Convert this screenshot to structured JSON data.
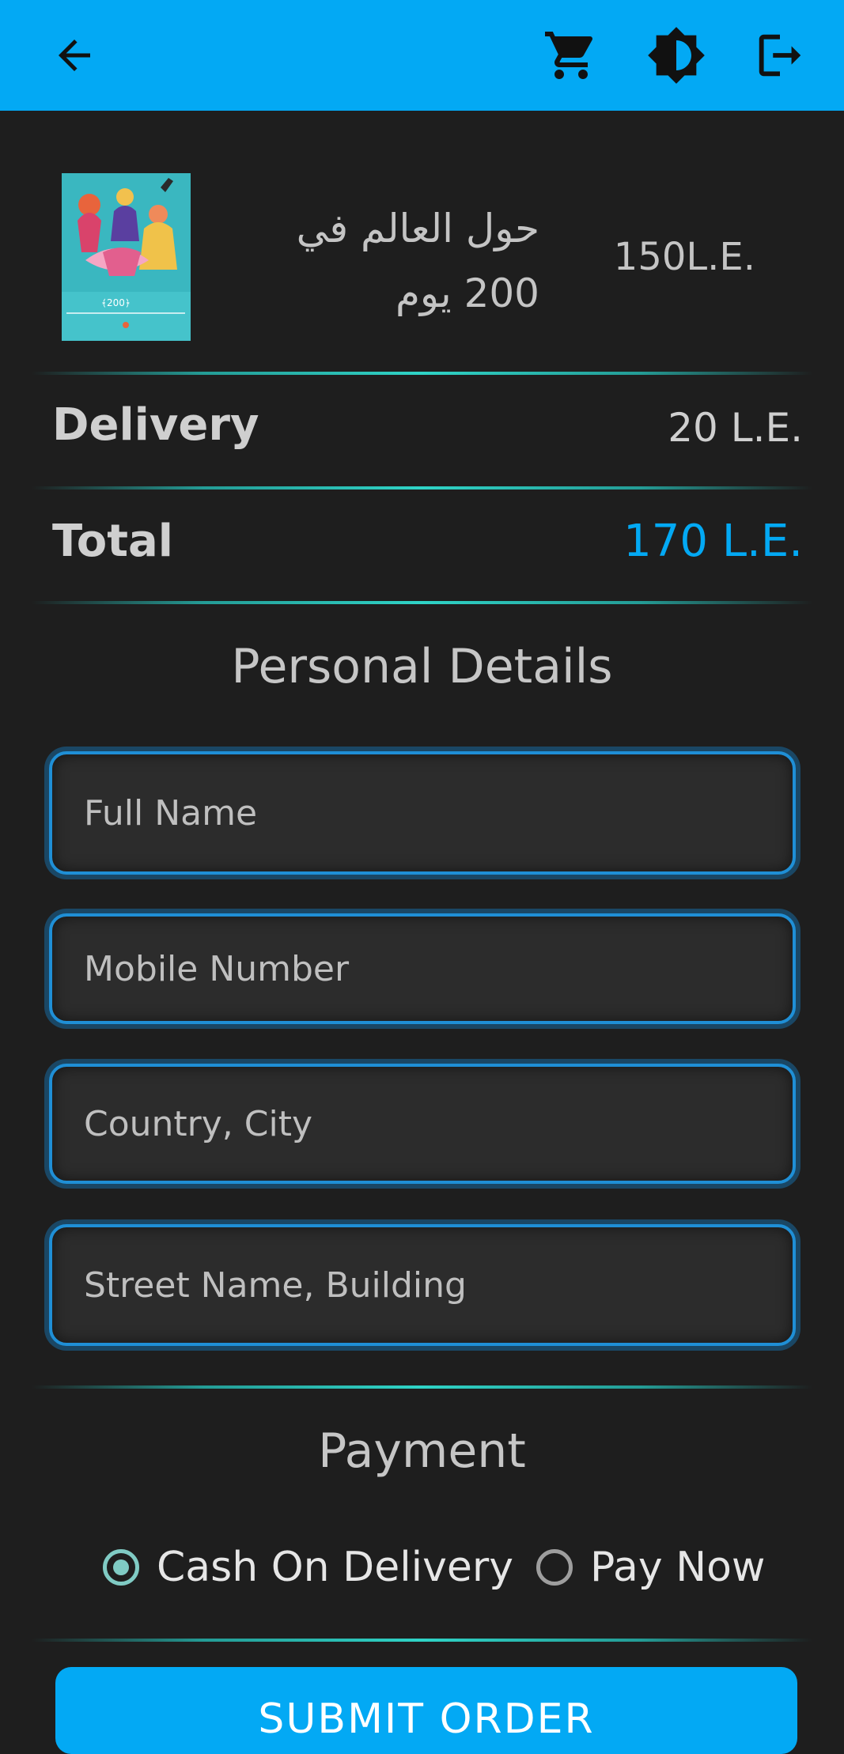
{
  "app_bar": {
    "back_icon": "arrow-back-icon",
    "cart_icon": "shopping-cart-icon",
    "theme_icon": "brightness-toggle-icon",
    "logout_icon": "logout-icon",
    "color": "#03a9f4"
  },
  "product": {
    "title": "حول العالم في 200 يوم",
    "price": "150L.E."
  },
  "delivery": {
    "label": "Delivery",
    "value": "20 L.E."
  },
  "total": {
    "label": "Total",
    "value": "170 L.E.",
    "value_color": "#03a9f4"
  },
  "personal_details": {
    "heading": "Personal Details",
    "full_name_placeholder": "Full Name",
    "mobile_placeholder": "Mobile Number",
    "country_city_placeholder": "Country, City",
    "street_placeholder": "Street Name, Building"
  },
  "payment": {
    "heading": "Payment",
    "options": [
      {
        "label": "Cash On Delivery",
        "selected": true
      },
      {
        "label": "Pay Now",
        "selected": false
      }
    ]
  },
  "submit_label": "SUBMIT ORDER"
}
